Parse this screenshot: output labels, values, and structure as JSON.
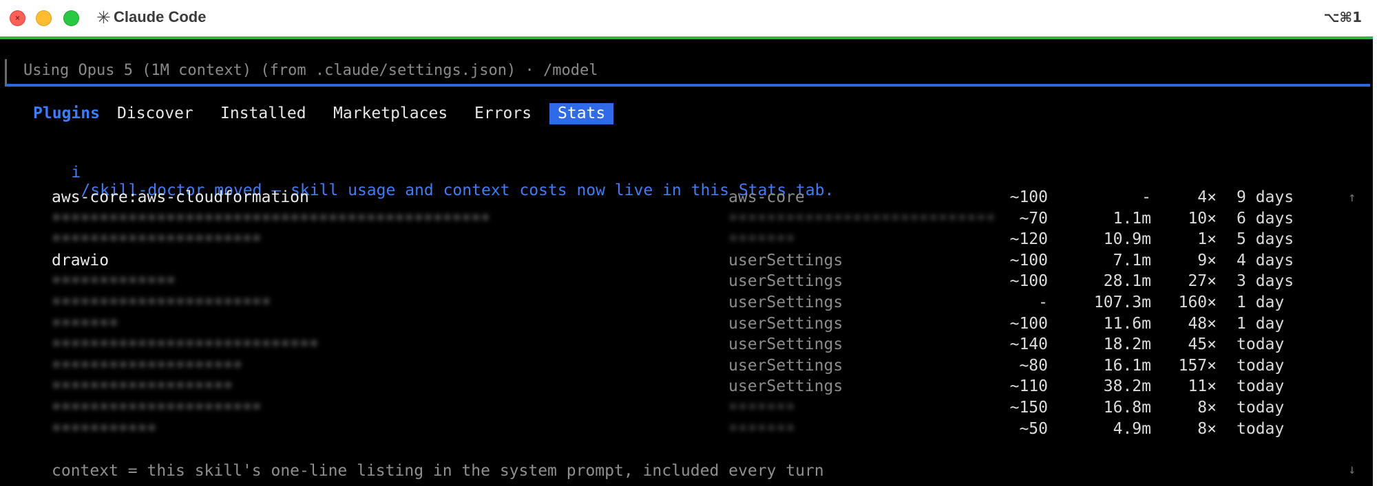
{
  "window": {
    "title": "Claude Code",
    "title_icon": "✳",
    "shortcut": "⌥⌘1"
  },
  "model_notice": "Using Opus 5 (1M context) (from .claude/settings.json) · /model",
  "tabs": {
    "title": "Plugins",
    "items": [
      "Discover",
      "Installed",
      "Marketplaces",
      "Errors",
      "Stats"
    ],
    "active": "Stats"
  },
  "info": {
    "icon": "i",
    "text": "/skill-doctor moved – skill usage and context costs now live in this Stats tab."
  },
  "skills": [
    {
      "name": "aws-core:aws-cloudformation",
      "source": "aws-core",
      "context": "~100",
      "tokens": "-",
      "uses": "4×",
      "last_used": "9 days",
      "redacted": false,
      "source_redacted": false
    },
    {
      "name": "••••••••••••••••••••••••••••••••••••••••••••••",
      "source": "••••••••••••••••••••••••••••",
      "context": "~70",
      "tokens": "1.1m",
      "uses": "10×",
      "last_used": "6 days",
      "redacted": true,
      "source_redacted": true
    },
    {
      "name": "••••••••••••••••••••••",
      "source": "•••••••",
      "context": "~120",
      "tokens": "10.9m",
      "uses": "1×",
      "last_used": "5 days",
      "redacted": true,
      "source_redacted": true
    },
    {
      "name": "drawio",
      "source": "userSettings",
      "context": "~100",
      "tokens": "7.1m",
      "uses": "9×",
      "last_used": "4 days",
      "redacted": false,
      "source_redacted": false
    },
    {
      "name": "•••••••••••••",
      "source": "userSettings",
      "context": "~100",
      "tokens": "28.1m",
      "uses": "27×",
      "last_used": "3 days",
      "redacted": true,
      "source_redacted": false
    },
    {
      "name": "•••••••••••••••••••••••",
      "source": "userSettings",
      "context": "-",
      "tokens": "107.3m",
      "uses": "160×",
      "last_used": "1 day",
      "redacted": true,
      "source_redacted": false
    },
    {
      "name": "•••••••",
      "source": "userSettings",
      "context": "~100",
      "tokens": "11.6m",
      "uses": "48×",
      "last_used": "1 day",
      "redacted": true,
      "source_redacted": false
    },
    {
      "name": "••••••••••••••••••••••••••••",
      "source": "userSettings",
      "context": "~140",
      "tokens": "18.2m",
      "uses": "45×",
      "last_used": "today",
      "redacted": true,
      "source_redacted": false
    },
    {
      "name": "••••••••••••••••••••",
      "source": "userSettings",
      "context": "~80",
      "tokens": "16.1m",
      "uses": "157×",
      "last_used": "today",
      "redacted": true,
      "source_redacted": false
    },
    {
      "name": "•••••••••••••••••••",
      "source": "userSettings",
      "context": "~110",
      "tokens": "38.2m",
      "uses": "11×",
      "last_used": "today",
      "redacted": true,
      "source_redacted": false
    },
    {
      "name": "••••••••••••••••••••••",
      "source": "•••••••",
      "context": "~150",
      "tokens": "16.8m",
      "uses": "8×",
      "last_used": "today",
      "redacted": true,
      "source_redacted": true
    },
    {
      "name": "•••••••••••",
      "source": "•••••••",
      "context": "~50",
      "tokens": "4.9m",
      "uses": "8×",
      "last_used": "today",
      "redacted": true,
      "source_redacted": true
    }
  ],
  "scroll": {
    "up": "↑",
    "down": "↓"
  },
  "footer": "context = this skill's one-line listing in the system prompt, included every turn",
  "colors": {
    "accent": "#2f6be8",
    "info": "#3f7cf5",
    "progress": "#32b544",
    "background": "#000000"
  }
}
